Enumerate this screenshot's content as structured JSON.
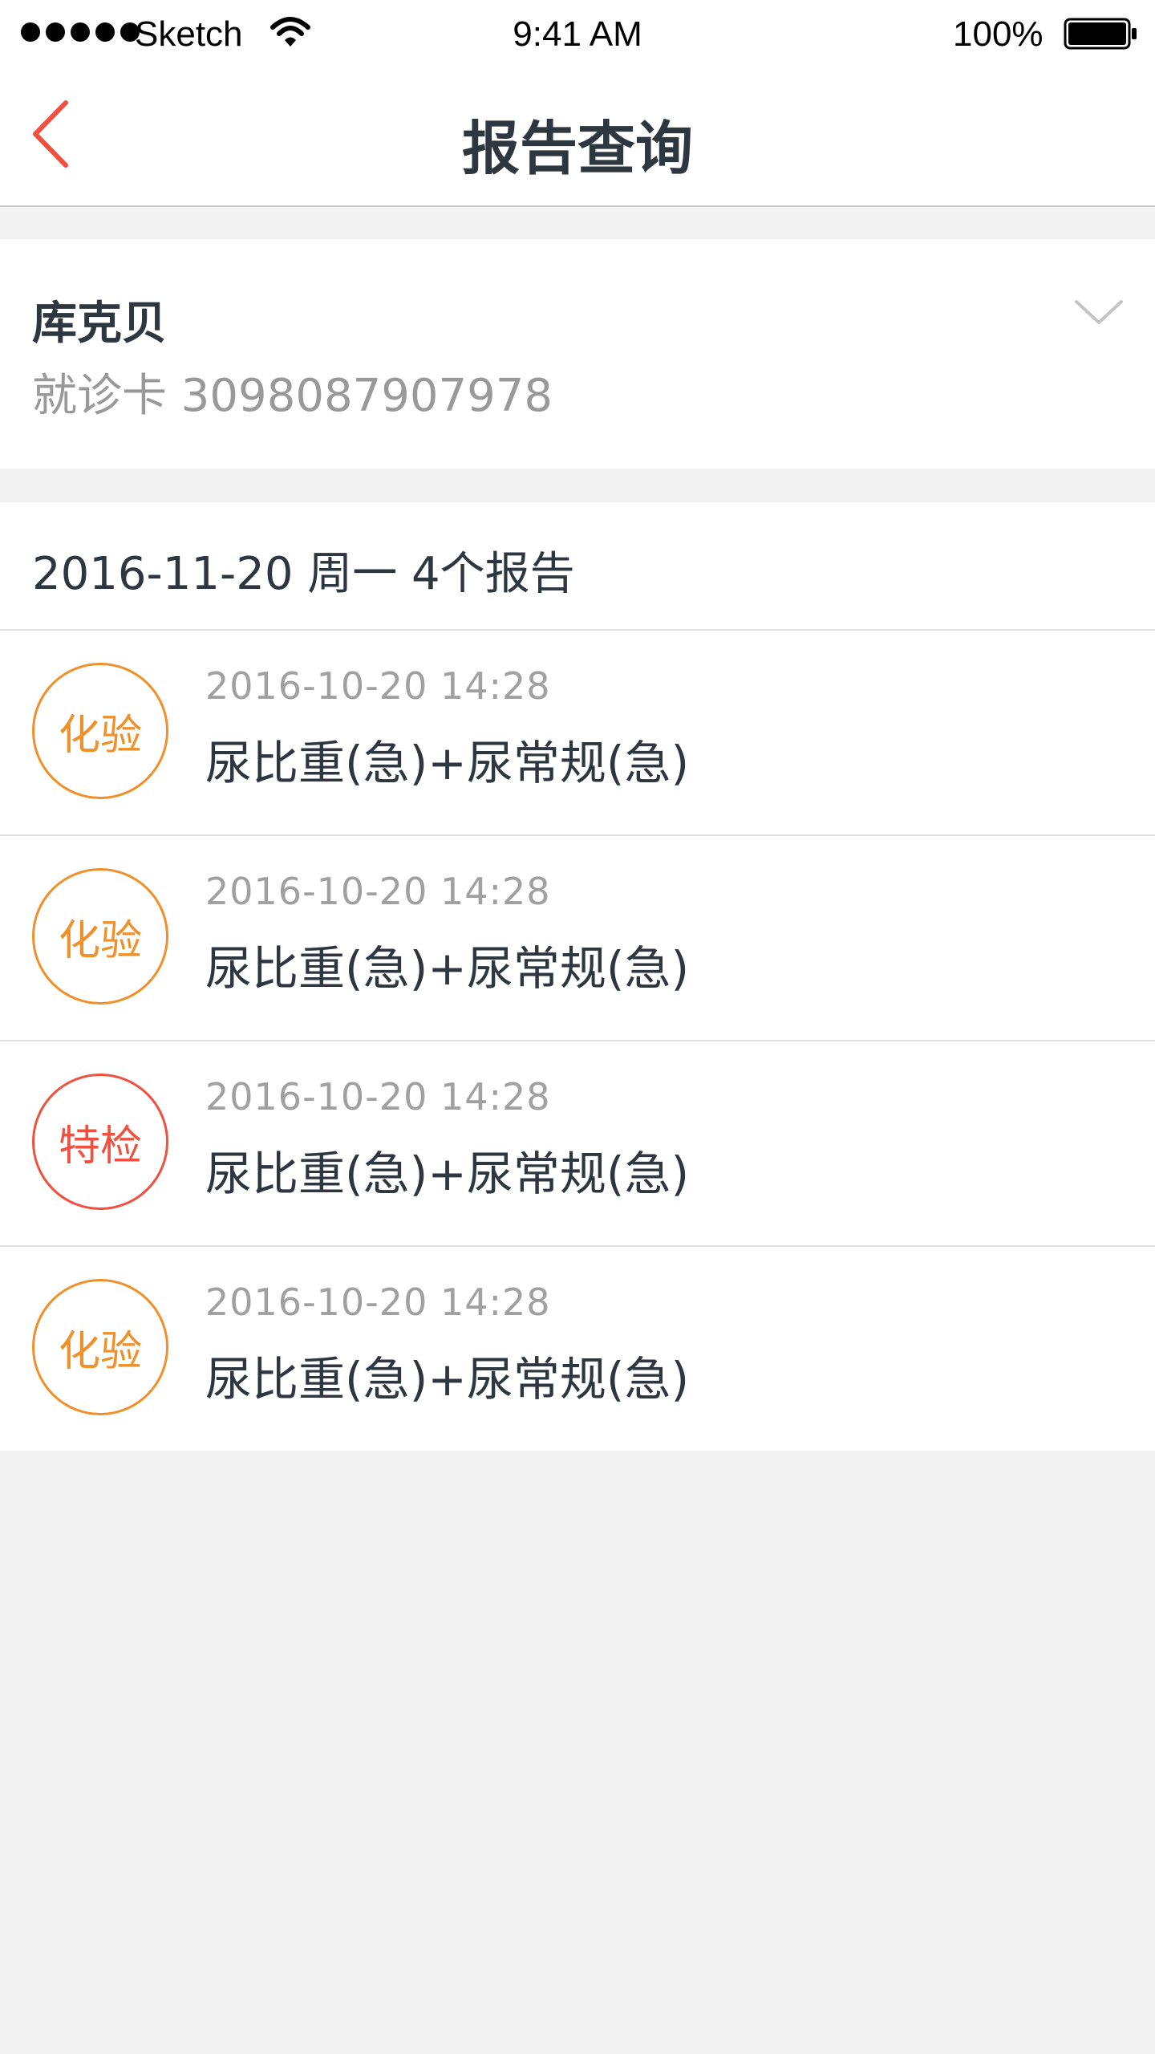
{
  "status_bar": {
    "carrier": "Sketch",
    "time": "9:41 AM",
    "battery": "100%"
  },
  "navbar": {
    "title": "报告查询",
    "back_icon": "chevron-left-icon",
    "accent_color": "#f05040"
  },
  "patient": {
    "name": "库克贝",
    "card": "就诊卡 3098087907978",
    "expand_icon": "chevron-down-icon"
  },
  "reports": {
    "group_header": "2016-11-20 周一 4个报告",
    "items": [
      {
        "type": "化验",
        "color": "#f0902a",
        "time": "2016-10-20   14:28",
        "title": "尿比重(急)+尿常规(急)"
      },
      {
        "type": "化验",
        "color": "#f0902a",
        "time": "2016-10-20   14:28",
        "title": "尿比重(急)+尿常规(急)"
      },
      {
        "type": "特检",
        "color": "#f05040",
        "time": "2016-10-20   14:28",
        "title": "尿比重(急)+尿常规(急)"
      },
      {
        "type": "化验",
        "color": "#f0902a",
        "time": "2016-10-20   14:28",
        "title": "尿比重(急)+尿常规(急)"
      }
    ]
  }
}
